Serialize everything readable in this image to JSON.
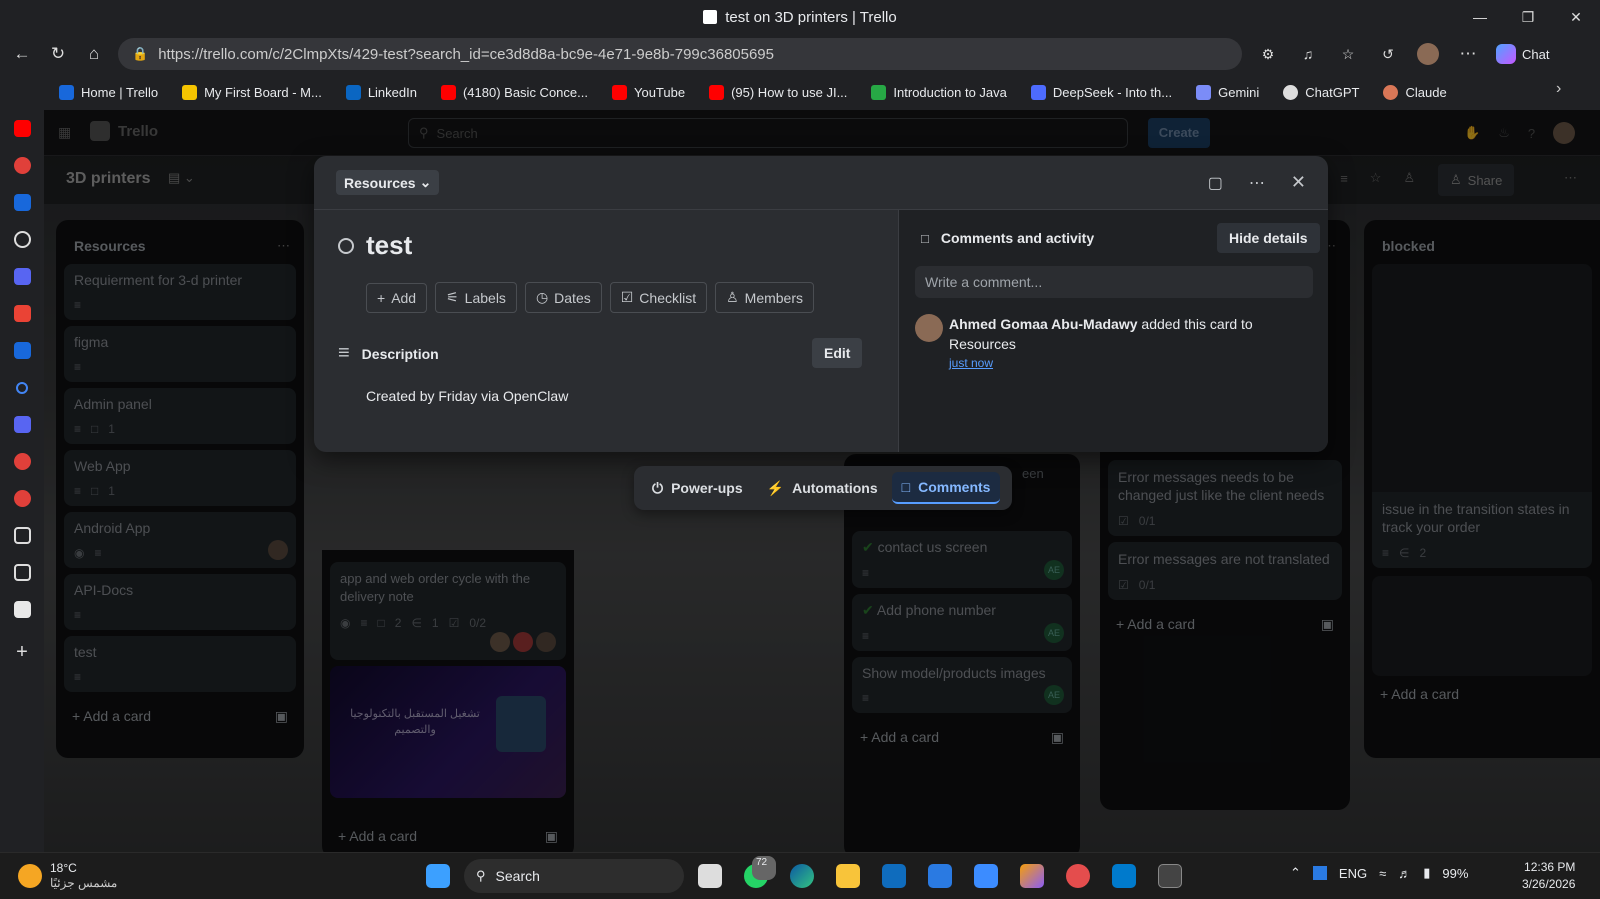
{
  "window": {
    "title": "test on 3D printers | Trello"
  },
  "browser": {
    "url": "https://trello.com/c/2ClmpXts/429-test?search_id=ce3d8d8a-bc9e-4e71-9e8b-799c36805695",
    "chat_label": "Chat",
    "bookmarks": [
      {
        "label": "Home | Trello",
        "color": "#1868db"
      },
      {
        "label": "My First Board - M...",
        "color": "#f5c400"
      },
      {
        "label": "LinkedIn",
        "color": "#0a66c2"
      },
      {
        "label": "(4180) Basic Conce...",
        "color": "#ff0000"
      },
      {
        "label": "YouTube",
        "color": "#ff0000"
      },
      {
        "label": "(95) How to use JI...",
        "color": "#ff0000"
      },
      {
        "label": "Introduction to Java",
        "color": "#27a845"
      },
      {
        "label": "DeepSeek - Into th...",
        "color": "#4d6bfe"
      },
      {
        "label": "Gemini",
        "color": "#7b8cf7"
      },
      {
        "label": "ChatGPT",
        "color": "#dddddd"
      },
      {
        "label": "Claude",
        "color": "#d97757"
      }
    ]
  },
  "trello": {
    "app_name": "Trello",
    "search_placeholder": "Search",
    "create_label": "Create",
    "board_name": "3D printers",
    "share_label": "Share",
    "lists": {
      "resources": {
        "title": "Resources",
        "cards": [
          {
            "title": "Requierment for 3-d printer",
            "meta": ""
          },
          {
            "title": "figma",
            "meta": ""
          },
          {
            "title": "Admin panel",
            "meta": "1"
          },
          {
            "title": "Web App",
            "meta": "1"
          },
          {
            "title": "Android App",
            "meta": ""
          },
          {
            "title": "API-Docs",
            "meta": ""
          },
          {
            "title": "test",
            "meta": ""
          }
        ],
        "add_card": "Add a card"
      },
      "second": {
        "card_text": "app and web order cycle with the delivery note",
        "meta_comments": "2",
        "meta_attach": "1",
        "meta_check": "0/2",
        "image_text": "تشغيل المستقبل بالتكنولوجيا والتصميم",
        "add_card": "Add a card"
      },
      "third": {
        "cards": [
          {
            "title": "contact us screen"
          },
          {
            "title": "Add phone number"
          },
          {
            "title": "Show model/products images"
          }
        ],
        "avatar": "AE",
        "partial": "een",
        "add_card": "Add a card"
      },
      "fourth": {
        "cards": [
          {
            "title": "Error messages needs to be changed just like the client needs",
            "check": "0/1"
          },
          {
            "title": "Error messages are not translated",
            "check": "0/1"
          }
        ],
        "add_card": "Add a card"
      },
      "blocked": {
        "title": "blocked",
        "card_text": "issue in the transition states in track your order",
        "attach": "2",
        "add_card": "Add a card"
      }
    },
    "modal": {
      "list_chip": "Resources",
      "card_title": "test",
      "actions": [
        "Add",
        "Labels",
        "Dates",
        "Checklist",
        "Members"
      ],
      "description_heading": "Description",
      "edit_label": "Edit",
      "description_text": "Created by Friday via OpenClaw",
      "activity_heading": "Comments and activity",
      "hide_details": "Hide details",
      "comment_placeholder": "Write a comment...",
      "activity_user": "Ahmed Gomaa Abu-Madawy",
      "activity_text": "added this card to Resources",
      "activity_time": "just now"
    },
    "toolbar": {
      "powerups": "Power-ups",
      "automations": "Automations",
      "comments": "Comments"
    }
  },
  "taskbar": {
    "weather_temp": "18°C",
    "weather_desc": "مشمس جزئيًا",
    "search_label": "Search",
    "whatsapp_badge": "72",
    "lang": "ENG",
    "battery": "99%",
    "time": "12:36 PM",
    "date": "3/26/2026"
  }
}
